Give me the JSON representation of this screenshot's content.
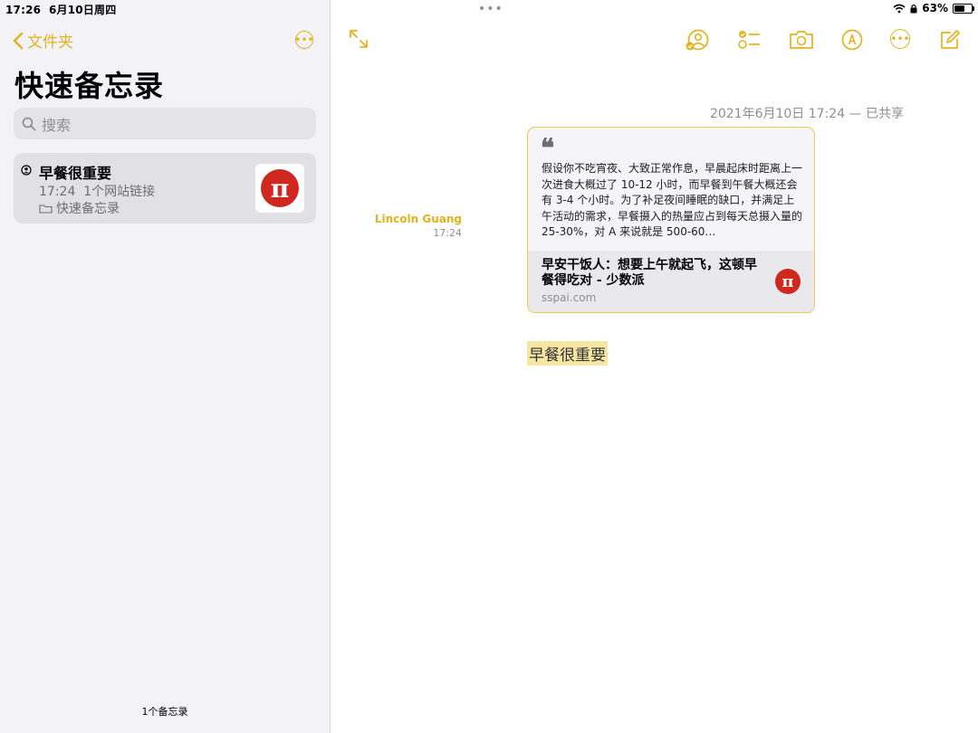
{
  "status": {
    "time": "17:26",
    "date": "6月10日周四",
    "battery": "63%",
    "battery_level": 0.63
  },
  "sidebar": {
    "back_label": "文件夹",
    "title": "快速备忘录",
    "search_placeholder": "搜索",
    "notes": [
      {
        "title": "早餐很重要",
        "time": "17:24",
        "snippet": "1个网站链接",
        "folder": "快速备忘录",
        "thumb_glyph": "π"
      }
    ],
    "count": "1个备忘录"
  },
  "note": {
    "date": "2021年6月10日 17:24 — 已共享",
    "author": "Lincoln Guang",
    "author_time": "17:24",
    "link": {
      "quote_glyph": "❝",
      "excerpt": "假设你不吃宵夜、大致正常作息，早晨起床时距离上一次进食大概过了 10-12 小时，而早餐到午餐大概还会有 3-4 个小时。为了补足夜间睡眠的缺口，并满足上午活动的需求，早餐摄入的热量应占到每天总摄入量的 25-30%，对 A 来说就是 500-60…",
      "title": "早安干饭人：想要上午就起飞，这顿早餐得吃对 - 少数派",
      "domain": "sspai.com",
      "logo_glyph": "π"
    },
    "body_text": "早餐很重要"
  },
  "colors": {
    "accent": "#e3b21c",
    "card_border": "#f0c94a",
    "highlight": "#f7e6a3",
    "logo_red": "#d0281e"
  },
  "icons": [
    "back-chevron-icon",
    "more-icon",
    "search-icon",
    "shared-icon",
    "folder-icon",
    "expand-icon",
    "collaborate-icon",
    "checklist-icon",
    "camera-icon",
    "markup-icon",
    "compose-icon",
    "wifi-icon",
    "lock-icon",
    "battery-icon"
  ]
}
